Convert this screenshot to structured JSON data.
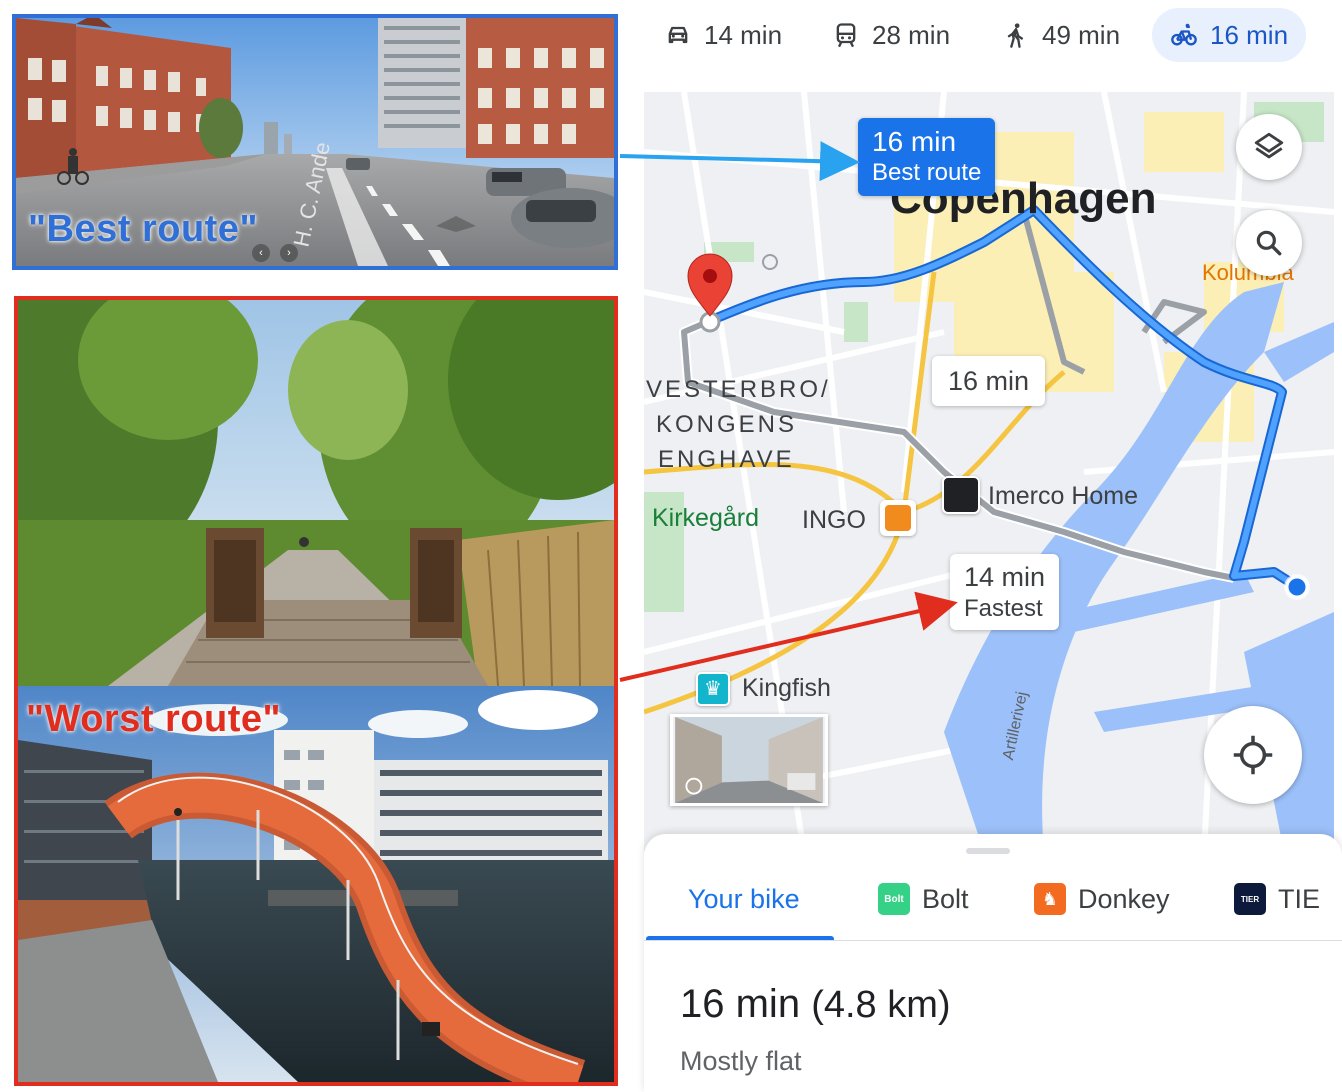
{
  "colors": {
    "best_route": "#2f6fd6",
    "worst_route": "#e02d1d",
    "map_route_blue": "#4285f4",
    "map_route_gray": "#9aa0a6",
    "active_tab": "#1a73e8"
  },
  "annotations": {
    "best_caption": "\"Best route\"",
    "worst_caption": "\"Worst route\""
  },
  "modes": [
    {
      "icon": "car-icon",
      "label": "14 min"
    },
    {
      "icon": "transit-icon",
      "label": "28 min"
    },
    {
      "icon": "walk-icon",
      "label": "49 min"
    },
    {
      "icon": "bike-icon",
      "label": "16 min",
      "selected": true
    }
  ],
  "map": {
    "city_label": "Copenhagen",
    "district_label": [
      "VESTERBRO/",
      "KONGENS",
      "ENGHAVE"
    ],
    "kirkegard": "Kirkegård",
    "ingo": "INGO",
    "imerco": "Imerco Home",
    "kingfish": "Kingfish",
    "kolumbia": "Kolumbia",
    "street": "Artillerivej",
    "best_chip": {
      "time": "16 min",
      "note": "Best route"
    },
    "alt_chip": {
      "time": "16 min"
    },
    "fast_chip": {
      "time": "14 min",
      "note": "Fastest"
    },
    "layers_icon": "layers-icon",
    "search_icon": "search-icon",
    "locate_icon": "locate-icon"
  },
  "sheet": {
    "providers": [
      {
        "label": "Your bike",
        "selected": true
      },
      {
        "label": "Bolt",
        "logo": "Bolt",
        "color": "#34d186"
      },
      {
        "label": "Donkey",
        "color": "#f26b21"
      },
      {
        "label": "TIE",
        "logo": "TIER",
        "color": "#0e1a3b"
      }
    ],
    "duration": "16 min",
    "distance": "(4.8 km)",
    "terrain": "Mostly flat"
  }
}
